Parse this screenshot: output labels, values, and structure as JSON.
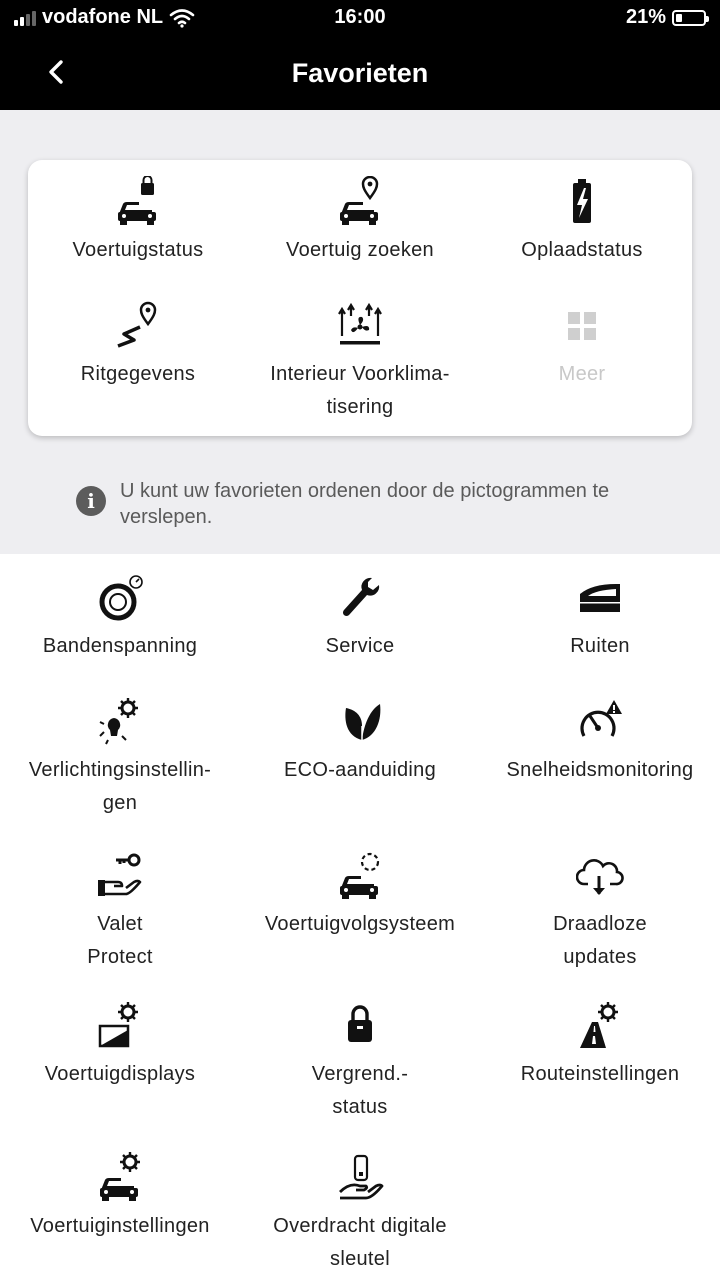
{
  "status_bar": {
    "carrier": "vodafone NL",
    "time": "16:00",
    "battery": "21%"
  },
  "nav": {
    "title": "Favorieten",
    "back_icon": "chevron-left-icon"
  },
  "favorites": [
    {
      "label": "Voertuigstatus",
      "icon": "car-lock-icon"
    },
    {
      "label": "Voertuig zoeken",
      "icon": "car-location-icon"
    },
    {
      "label": "Oplaadstatus",
      "icon": "battery-charge-icon"
    },
    {
      "label": "Ritgegevens",
      "icon": "route-pin-icon"
    },
    {
      "label": "Interieur Voorklima-\ntisering",
      "icon": "climate-fan-icon"
    },
    {
      "label": "Meer",
      "icon": "grid-icon",
      "disabled": true
    }
  ],
  "info": {
    "text": "U kunt uw favorieten ordenen door de pictogrammen te verslepen.",
    "icon": "info-icon"
  },
  "functions": [
    {
      "label": "Bandenspanning",
      "icon": "tire-pressure-icon"
    },
    {
      "label": "Service",
      "icon": "wrench-icon"
    },
    {
      "label": "Ruiten",
      "icon": "car-window-icon"
    },
    {
      "label": "Verlichtingsinstellin-\ngen",
      "icon": "light-settings-icon"
    },
    {
      "label": "ECO-aanduiding",
      "icon": "leaf-icon"
    },
    {
      "label": "Snelheidsmonitoring",
      "icon": "speedometer-warning-icon"
    },
    {
      "label": "Valet\nProtect",
      "icon": "hand-key-icon"
    },
    {
      "label": "Voertuigvolgsysteem",
      "icon": "car-tracking-icon"
    },
    {
      "label": "Draadloze\nupdates",
      "icon": "cloud-download-icon"
    },
    {
      "label": "Voertuigdisplays",
      "icon": "display-settings-icon"
    },
    {
      "label": "Vergrend.-\nstatus",
      "icon": "lock-icon"
    },
    {
      "label": "Routeinstellingen",
      "icon": "road-settings-icon"
    },
    {
      "label": "Voertuiginstellingen",
      "icon": "car-settings-icon"
    },
    {
      "label": "Overdracht digitale\nsleutel",
      "icon": "hand-phone-icon"
    }
  ]
}
